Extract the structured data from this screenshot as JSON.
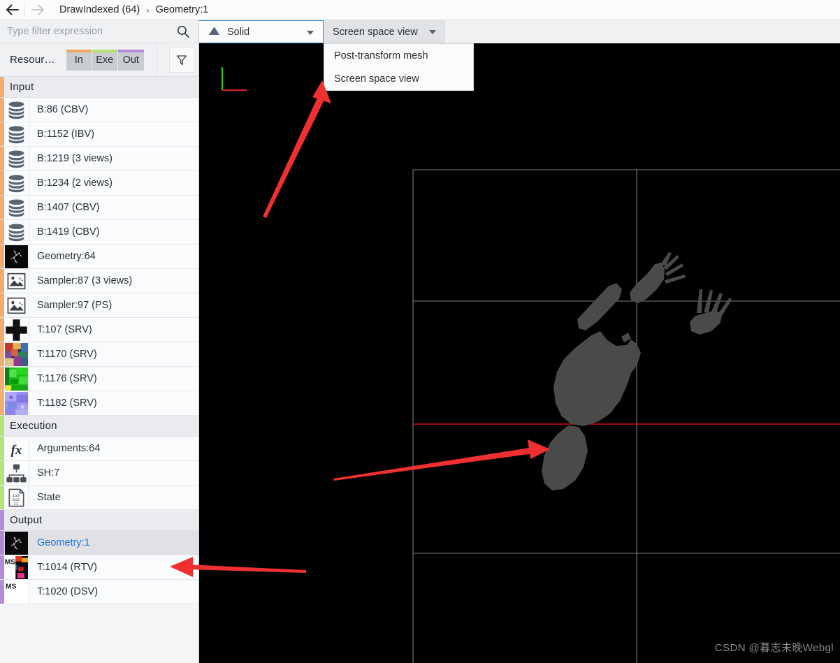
{
  "window": {
    "breadcrumb": {
      "back_icon": "arrow-left-icon",
      "forward_icon": "arrow-right-icon",
      "items": [
        "DrawIndexed (64)",
        "Geometry:1"
      ],
      "separator": "›"
    }
  },
  "left_panel": {
    "filter": {
      "placeholder": "Type filter expression",
      "value": "",
      "search_icon": "search-icon"
    },
    "toolbar": {
      "resources_label": "Resour…",
      "toggles": [
        {
          "label": "In",
          "color": "#f0a860",
          "active": true
        },
        {
          "label": "Exe",
          "color": "#b5e06a",
          "active": true
        },
        {
          "label": "Out",
          "color": "#b48bd8",
          "active": true
        }
      ],
      "filter_icon": "funnel-icon"
    },
    "sections": [
      {
        "title": "Input",
        "stripe_color": "#f3ab6e",
        "rows": [
          {
            "label": "B:86 (CBV)",
            "icon": "buffer-icon",
            "selected": false
          },
          {
            "label": "B:1152 (IBV)",
            "icon": "buffer-icon",
            "selected": false
          },
          {
            "label": "B:1219 (3 views)",
            "icon": "buffer-icon",
            "selected": false
          },
          {
            "label": "B:1234 (2 views)",
            "icon": "buffer-icon",
            "selected": false
          },
          {
            "label": "B:1407 (CBV)",
            "icon": "buffer-icon",
            "selected": false
          },
          {
            "label": "B:1419 (CBV)",
            "icon": "buffer-icon",
            "selected": false
          },
          {
            "label": "Geometry:64",
            "icon": "mesh-thumbnail-icon",
            "selected": false
          },
          {
            "label": "Sampler:87 (3 views)",
            "icon": "sampler-icon",
            "selected": false
          },
          {
            "label": "Sampler:97 (PS)",
            "icon": "sampler-icon",
            "selected": false
          },
          {
            "label": "T:107 (SRV)",
            "icon": "texture-cross-thumbnail-icon",
            "selected": false
          },
          {
            "label": "T:1170 (SRV)",
            "icon": "texture-color-thumbnail-icon",
            "selected": false
          },
          {
            "label": "T:1176 (SRV)",
            "icon": "texture-green-thumbnail-icon",
            "selected": false
          },
          {
            "label": "T:1182 (SRV)",
            "icon": "texture-purple-thumbnail-icon",
            "selected": false
          }
        ]
      },
      {
        "title": "Execution",
        "stripe_color": "#b7e27a",
        "rows": [
          {
            "label": "Arguments:64",
            "icon": "fx-icon",
            "selected": false
          },
          {
            "label": "SH:7",
            "icon": "shader-icon",
            "selected": false
          },
          {
            "label": "State",
            "icon": "state-icon",
            "selected": false
          }
        ]
      },
      {
        "title": "Output",
        "stripe_color": "#b48bd8",
        "rows": [
          {
            "label": "Geometry:1",
            "icon": "mesh-thumbnail-icon",
            "selected": true
          },
          {
            "label": "T:1014 (RTV)",
            "icon": "ms-texture-thumbnail-icon",
            "selected": false
          },
          {
            "label": "T:1020 (DSV)",
            "icon": "ms-depth-thumbnail-icon",
            "selected": false
          }
        ]
      }
    ]
  },
  "viewport": {
    "toolbar": {
      "draw_mode": {
        "label": "Solid",
        "icon": "triangle-icon",
        "chevron": "chevron-down-icon"
      },
      "view_mode": {
        "label": "Screen space view",
        "chevron": "chevron-down-icon"
      }
    },
    "dropdown_open": true,
    "dropdown_items": [
      "Post-transform mesh",
      "Screen space view"
    ],
    "axis_gizmo": {
      "y_axis_color": "#22cc22",
      "x_axis_color": "#dd2222"
    },
    "grid_color": "#7d7d7d",
    "guide_line_color": "#cc1111",
    "mesh_color": "#4a4a4a",
    "background": "#000000"
  },
  "annotations": {
    "arrow_color": "#f03030",
    "arrows": [
      {
        "name": "arrow-to-view-mode-dropdown"
      },
      {
        "name": "arrow-to-mesh"
      },
      {
        "name": "arrow-to-geometry-output"
      }
    ]
  },
  "watermark": {
    "text": "CSDN @暮志未晚Webgl"
  }
}
